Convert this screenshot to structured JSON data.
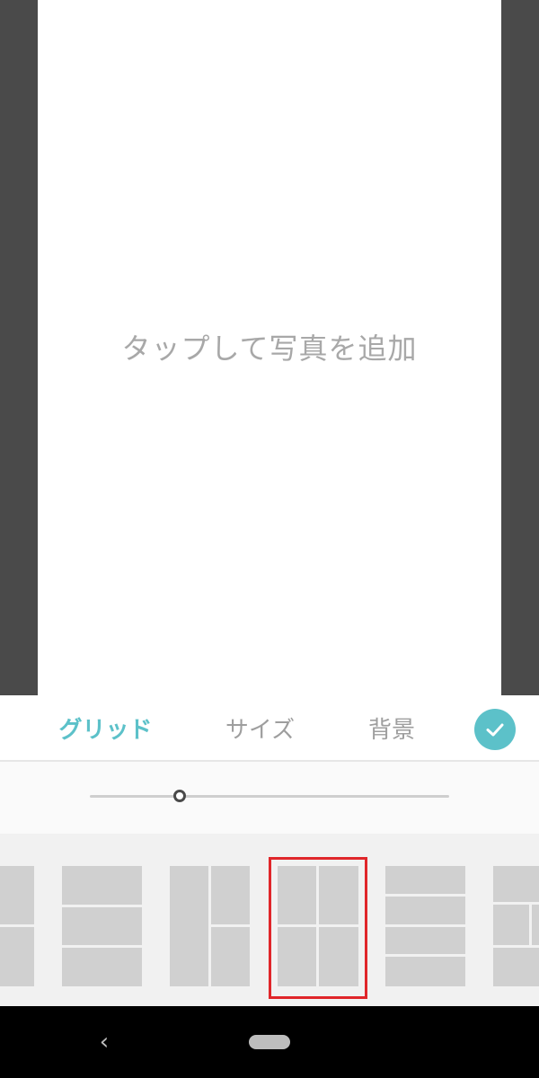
{
  "canvas": {
    "hint": "タップして写真を追加"
  },
  "tabs": [
    {
      "label": "グリッド",
      "active": true
    },
    {
      "label": "サイズ",
      "active": false
    },
    {
      "label": "背景",
      "active": false
    }
  ],
  "confirm": {
    "icon": "check-icon"
  },
  "slider": {
    "value_fraction": 0.25
  },
  "layouts": {
    "selected_index": 3,
    "items": [
      {
        "name": "two-rows"
      },
      {
        "name": "three-rows"
      },
      {
        "name": "left-column-right-two"
      },
      {
        "name": "grid-2x2"
      },
      {
        "name": "four-rows"
      },
      {
        "name": "mixed-grid"
      }
    ]
  },
  "navbar": {
    "back_icon": "back-chevron-icon",
    "home_icon": "home-pill-icon"
  },
  "colors": {
    "accent": "#5cc1c9",
    "selection": "#e0262a",
    "cell": "#d0d0d0",
    "sidebar_dark": "#4a4a4a"
  }
}
